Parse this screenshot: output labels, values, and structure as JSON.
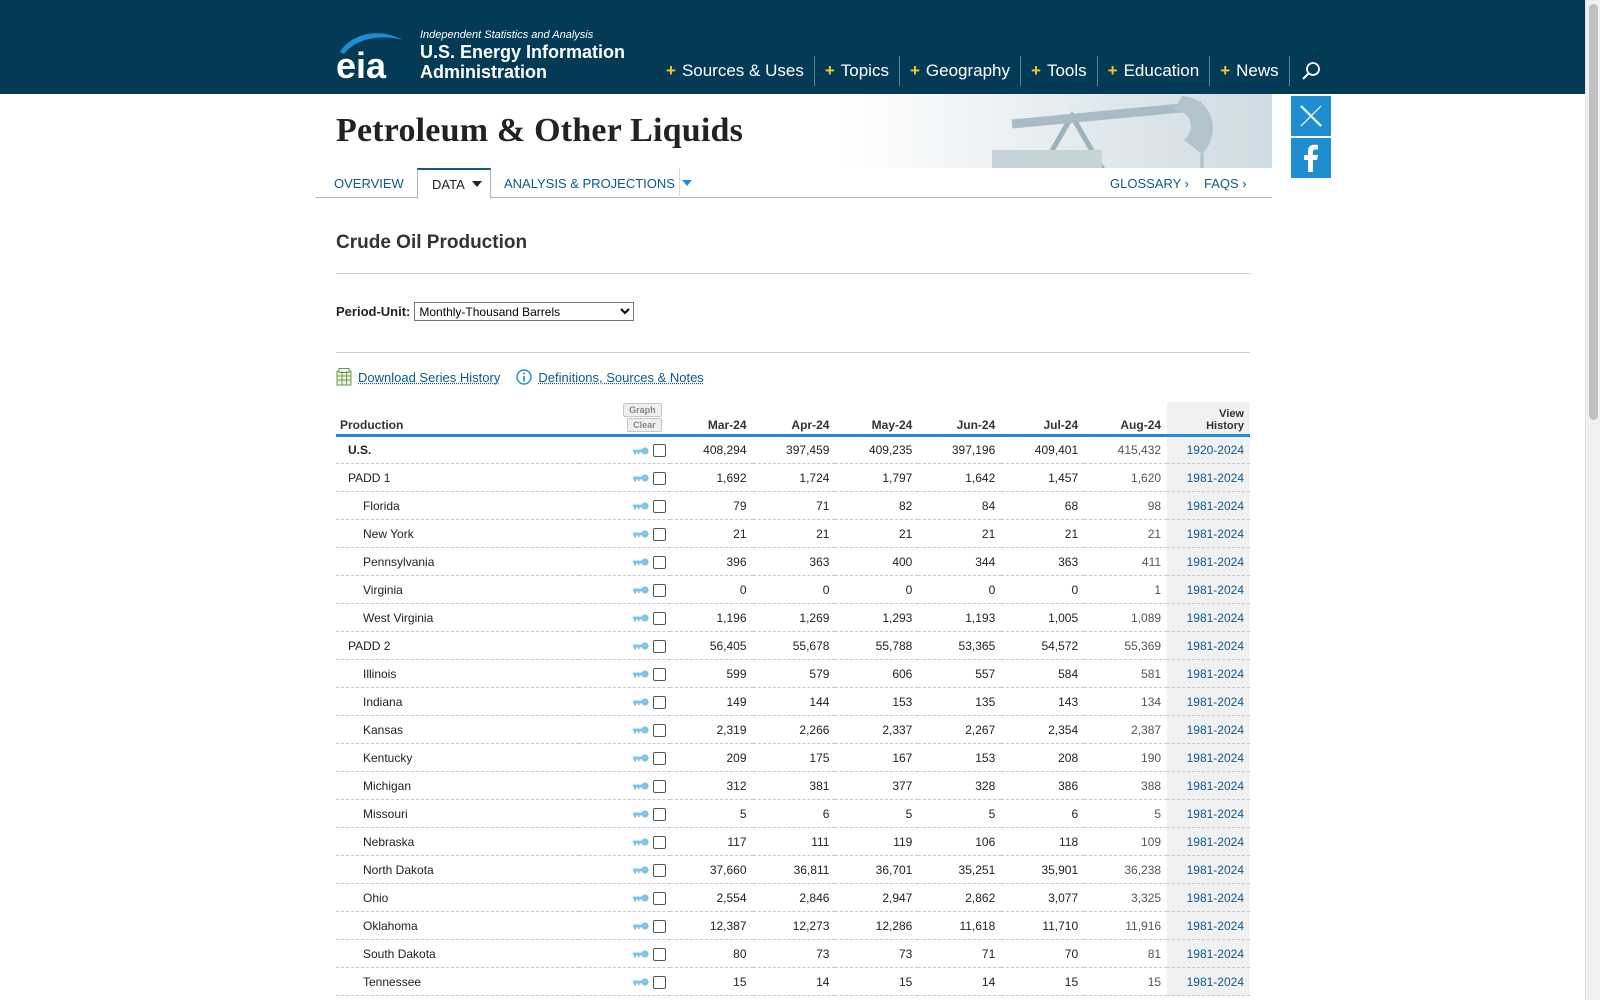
{
  "header": {
    "tagline": "Independent Statistics and Analysis",
    "org_name": "U.S. Energy Information Administration",
    "logo_text": "eia",
    "nav": [
      {
        "label": "Sources & Uses"
      },
      {
        "label": "Topics"
      },
      {
        "label": "Geography"
      },
      {
        "label": "Tools"
      },
      {
        "label": "Education"
      },
      {
        "label": "News"
      }
    ]
  },
  "banner": {
    "title": "Petroleum & Other Liquids"
  },
  "subnav": {
    "tabs": [
      {
        "label": "Overview"
      },
      {
        "label": "Data"
      },
      {
        "label": "Analysis & Projections"
      }
    ],
    "glossary": "Glossary ›",
    "faqs": "FAQs ›"
  },
  "page": {
    "title": "Crude Oil Production",
    "period_label": "Period-Unit:",
    "period_value": "Monthly-Thousand Barrels",
    "download_link": "Download Series History",
    "definitions_link": "Definitions, Sources & Notes"
  },
  "table": {
    "production_header": "Production",
    "graph_button": "Graph",
    "clear_button": "Clear",
    "columns": [
      "Mar-24",
      "Apr-24",
      "May-24",
      "Jun-24",
      "Jul-24",
      "Aug-24"
    ],
    "history_header_line1": "View",
    "history_header_line2": "History",
    "rows": [
      {
        "name": "U.S.",
        "level": 1,
        "bold": true,
        "values": [
          "408,294",
          "397,459",
          "409,235",
          "397,196",
          "409,401",
          "415,432"
        ],
        "history": "1920-2024"
      },
      {
        "name": "PADD 1",
        "level": 1,
        "bold": false,
        "values": [
          "1,692",
          "1,724",
          "1,797",
          "1,642",
          "1,457",
          "1,620"
        ],
        "history": "1981-2024"
      },
      {
        "name": "Florida",
        "level": 2,
        "bold": false,
        "values": [
          "79",
          "71",
          "82",
          "84",
          "68",
          "98"
        ],
        "history": "1981-2024"
      },
      {
        "name": "New York",
        "level": 2,
        "bold": false,
        "values": [
          "21",
          "21",
          "21",
          "21",
          "21",
          "21"
        ],
        "history": "1981-2024"
      },
      {
        "name": "Pennsylvania",
        "level": 2,
        "bold": false,
        "values": [
          "396",
          "363",
          "400",
          "344",
          "363",
          "411"
        ],
        "history": "1981-2024"
      },
      {
        "name": "Virginia",
        "level": 2,
        "bold": false,
        "values": [
          "0",
          "0",
          "0",
          "0",
          "0",
          "1"
        ],
        "history": "1981-2024"
      },
      {
        "name": "West Virginia",
        "level": 2,
        "bold": false,
        "values": [
          "1,196",
          "1,269",
          "1,293",
          "1,193",
          "1,005",
          "1,089"
        ],
        "history": "1981-2024"
      },
      {
        "name": "PADD 2",
        "level": 1,
        "bold": false,
        "values": [
          "56,405",
          "55,678",
          "55,788",
          "53,365",
          "54,572",
          "55,369"
        ],
        "history": "1981-2024"
      },
      {
        "name": "Illinois",
        "level": 2,
        "bold": false,
        "values": [
          "599",
          "579",
          "606",
          "557",
          "584",
          "581"
        ],
        "history": "1981-2024"
      },
      {
        "name": "Indiana",
        "level": 2,
        "bold": false,
        "values": [
          "149",
          "144",
          "153",
          "135",
          "143",
          "134"
        ],
        "history": "1981-2024"
      },
      {
        "name": "Kansas",
        "level": 2,
        "bold": false,
        "values": [
          "2,319",
          "2,266",
          "2,337",
          "2,267",
          "2,354",
          "2,387"
        ],
        "history": "1981-2024"
      },
      {
        "name": "Kentucky",
        "level": 2,
        "bold": false,
        "values": [
          "209",
          "175",
          "167",
          "153",
          "208",
          "190"
        ],
        "history": "1981-2024"
      },
      {
        "name": "Michigan",
        "level": 2,
        "bold": false,
        "values": [
          "312",
          "381",
          "377",
          "328",
          "386",
          "388"
        ],
        "history": "1981-2024"
      },
      {
        "name": "Missouri",
        "level": 2,
        "bold": false,
        "values": [
          "5",
          "6",
          "5",
          "5",
          "6",
          "5"
        ],
        "history": "1981-2024"
      },
      {
        "name": "Nebraska",
        "level": 2,
        "bold": false,
        "values": [
          "117",
          "111",
          "119",
          "106",
          "118",
          "109"
        ],
        "history": "1981-2024"
      },
      {
        "name": "North Dakota",
        "level": 2,
        "bold": false,
        "values": [
          "37,660",
          "36,811",
          "36,701",
          "35,251",
          "35,901",
          "36,238"
        ],
        "history": "1981-2024"
      },
      {
        "name": "Ohio",
        "level": 2,
        "bold": false,
        "values": [
          "2,554",
          "2,846",
          "2,947",
          "2,862",
          "3,077",
          "3,325"
        ],
        "history": "1981-2024"
      },
      {
        "name": "Oklahoma",
        "level": 2,
        "bold": false,
        "values": [
          "12,387",
          "12,273",
          "12,286",
          "11,618",
          "11,710",
          "11,916"
        ],
        "history": "1981-2024"
      },
      {
        "name": "South Dakota",
        "level": 2,
        "bold": false,
        "values": [
          "80",
          "73",
          "73",
          "71",
          "70",
          "81"
        ],
        "history": "1981-2024"
      },
      {
        "name": "Tennessee",
        "level": 2,
        "bold": false,
        "values": [
          "15",
          "14",
          "15",
          "14",
          "15",
          "15"
        ],
        "history": "1981-2024"
      }
    ]
  },
  "colors": {
    "header_bg": "#033a55",
    "accent_blue": "#1e8ed1",
    "link_blue": "#0a5a8c",
    "plus_yellow": "#f7c52a"
  }
}
